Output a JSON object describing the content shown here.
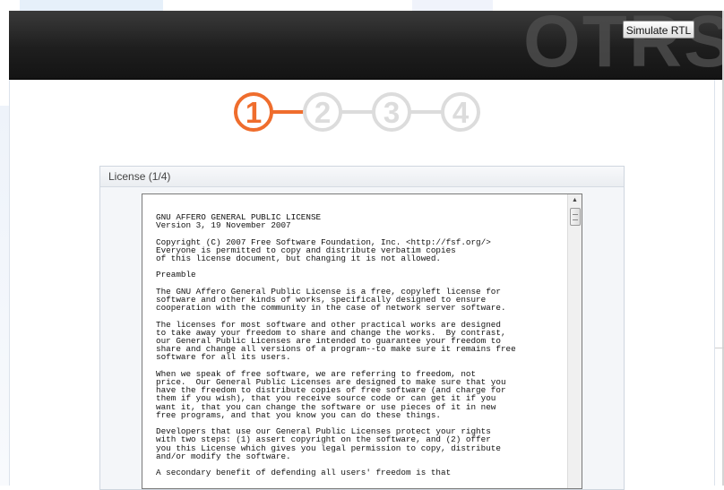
{
  "header": {
    "logo": "OTRS",
    "simulate_rtl_label": "Simulate RTL"
  },
  "steps": {
    "items": [
      "1",
      "2",
      "3",
      "4"
    ],
    "current": 1,
    "active_color": "#ef6d2d",
    "inactive_color": "#dcdcdc"
  },
  "panel": {
    "title": "License (1/4)"
  },
  "license_text": "GNU AFFERO GENERAL PUBLIC LICENSE\nVersion 3, 19 November 2007\n\nCopyright (C) 2007 Free Software Foundation, Inc. <http://fsf.org/>\nEveryone is permitted to copy and distribute verbatim copies\nof this license document, but changing it is not allowed.\n\nPreamble\n\nThe GNU Affero General Public License is a free, copyleft license for\nsoftware and other kinds of works, specifically designed to ensure\ncooperation with the community in the case of network server software.\n\nThe licenses for most software and other practical works are designed\nto take away your freedom to share and change the works.  By contrast,\nour General Public Licenses are intended to guarantee your freedom to\nshare and change all versions of a program--to make sure it remains free\nsoftware for all its users.\n\nWhen we speak of free software, we are referring to freedom, not\nprice.  Our General Public Licenses are designed to make sure that you\nhave the freedom to distribute copies of free software (and charge for\nthem if you wish), that you receive source code or can get it if you\nwant it, that you can change the software or use pieces of it in new\nfree programs, and that you know you can do these things.\n\nDevelopers that use our General Public Licenses protect your rights\nwith two steps: (1) assert copyright on the software, and (2) offer\nyou this License which gives you legal permission to copy, distribute\nand/or modify the software.\n\nA secondary benefit of defending all users' freedom is that"
}
